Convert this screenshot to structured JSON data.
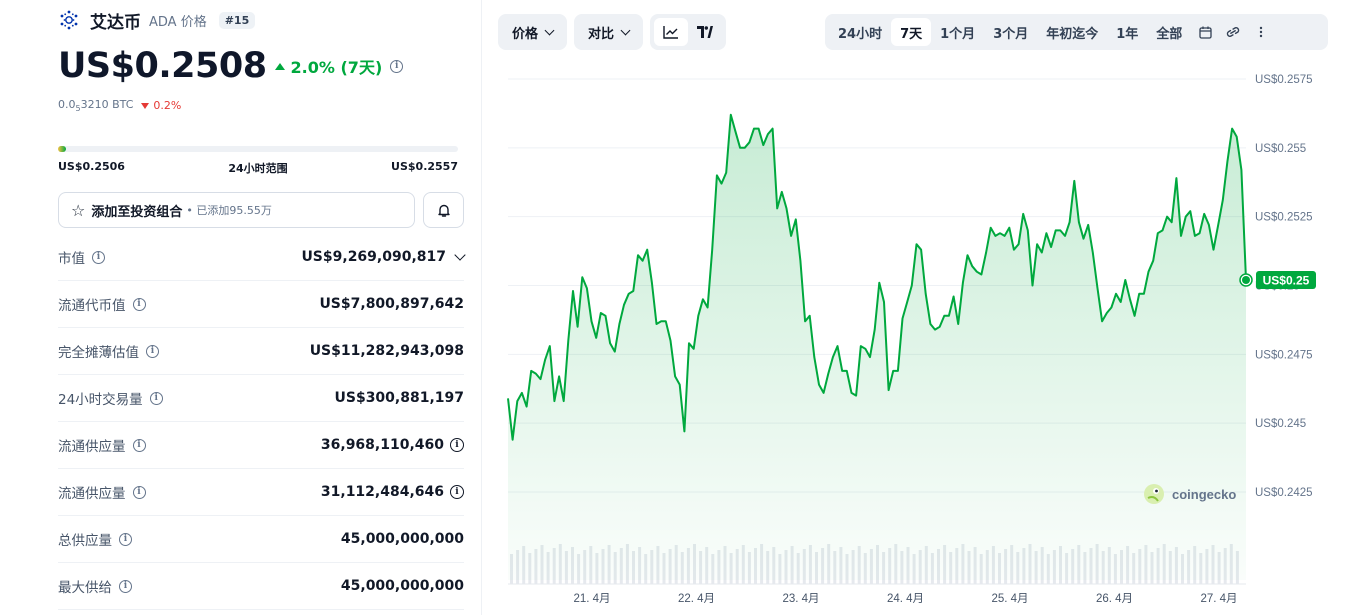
{
  "coin": {
    "name": "艾达币",
    "symbol_label": "ADA 价格",
    "rank": "#15",
    "price": "US$0.2508",
    "change": "2.0% (7天)",
    "btc_price_prefix": "0.0",
    "btc_price_sub": "5",
    "btc_price_rest": "3210 BTC",
    "btc_change": "0.2%",
    "colors": {
      "up": "#00a83e",
      "down": "#e53935",
      "logo": "#0033ad"
    }
  },
  "range": {
    "low": "US$0.2506",
    "label": "24小时范围",
    "high": "US$0.2557",
    "position_pct": 2
  },
  "portfolio": {
    "button_label": "添加至投资组合",
    "added_text": "• 已添加95.55万"
  },
  "stats": [
    {
      "label": "市值",
      "value": "US$9,269,090,817",
      "extra": "chevron-down"
    },
    {
      "label": "流通代币值",
      "value": "US$7,800,897,642"
    },
    {
      "label": "完全摊薄估值",
      "value": "US$11,282,943,098"
    },
    {
      "label": "24小时交易量",
      "value": "US$300,881,197"
    },
    {
      "label": "流通供应量",
      "value": "36,968,110,460",
      "extra": "info"
    },
    {
      "label": "流通供应量",
      "value": "31,112,484,646",
      "extra": "info"
    },
    {
      "label": "总供应量",
      "value": "45,000,000,000"
    },
    {
      "label": "最大供给",
      "value": "45,000,000,000"
    }
  ],
  "toolbar": {
    "price_label": "价格",
    "compare_label": "对比",
    "timeframes": [
      "24小时",
      "7天",
      "1个月",
      "3个月",
      "年初迄今",
      "1年",
      "全部"
    ],
    "active_timeframe": "7天"
  },
  "chart_data": {
    "type": "area",
    "y_ticks": [
      "US$0.2575",
      "US$0.255",
      "US$0.2525",
      "US$0.25",
      "US$0.2475",
      "US$0.245",
      "US$0.2425"
    ],
    "ylim": [
      0.2425,
      0.2575
    ],
    "x_ticks": [
      "21. 4月",
      "22. 4月",
      "23. 4月",
      "24. 4月",
      "25. 4月",
      "26. 4月",
      "27. 4月"
    ],
    "current_price_label": "US$0.25",
    "current_price": 0.2502,
    "watermark": "coingecko",
    "line_color": "#00a83e",
    "series": [
      {
        "values": [
          0.2459,
          0.2444,
          0.2458,
          0.2461,
          0.2456,
          0.2469,
          0.2468,
          0.2466,
          0.2473,
          0.2478,
          0.2458,
          0.2467,
          0.2458,
          0.248,
          0.2498,
          0.2485,
          0.2503,
          0.2499,
          0.2487,
          0.2481,
          0.249,
          0.2489,
          0.2479,
          0.2476,
          0.2486,
          0.2493,
          0.2497,
          0.2498,
          0.2511,
          0.2509,
          0.2513,
          0.2501,
          0.2486,
          0.2487,
          0.2487,
          0.248,
          0.2467,
          0.2464,
          0.2447,
          0.2479,
          0.2477,
          0.2489,
          0.2495,
          0.2492,
          0.2513,
          0.254,
          0.2537,
          0.2541,
          0.2562,
          0.2556,
          0.255,
          0.255,
          0.2552,
          0.2557,
          0.2557,
          0.2551,
          0.2555,
          0.2557,
          0.2528,
          0.2534,
          0.2528,
          0.2518,
          0.2524,
          0.2509,
          0.2487,
          0.2489,
          0.2474,
          0.2464,
          0.2461,
          0.2468,
          0.2474,
          0.2478,
          0.2469,
          0.2469,
          0.2461,
          0.246,
          0.2478,
          0.2477,
          0.2474,
          0.2484,
          0.2501,
          0.2494,
          0.2462,
          0.2469,
          0.2469,
          0.2488,
          0.2494,
          0.25,
          0.2515,
          0.2513,
          0.2497,
          0.2486,
          0.2484,
          0.2485,
          0.2489,
          0.2489,
          0.2496,
          0.2486,
          0.2501,
          0.2511,
          0.2507,
          0.2505,
          0.2504,
          0.2512,
          0.2521,
          0.2518,
          0.2519,
          0.2518,
          0.2521,
          0.2513,
          0.2515,
          0.2526,
          0.252,
          0.25,
          0.2515,
          0.2512,
          0.2519,
          0.2514,
          0.252,
          0.252,
          0.2518,
          0.2523,
          0.2538,
          0.2523,
          0.2517,
          0.2522,
          0.2512,
          0.2499,
          0.2487,
          0.249,
          0.2492,
          0.2497,
          0.2494,
          0.2502,
          0.2495,
          0.2489,
          0.2497,
          0.2497,
          0.2505,
          0.2509,
          0.2519,
          0.252,
          0.2525,
          0.2523,
          0.2539,
          0.2518,
          0.2525,
          0.2527,
          0.2518,
          0.2519,
          0.2526,
          0.2522,
          0.2513,
          0.2522,
          0.2531,
          0.2545,
          0.2557,
          0.2554,
          0.2542,
          0.2502
        ]
      }
    ]
  }
}
